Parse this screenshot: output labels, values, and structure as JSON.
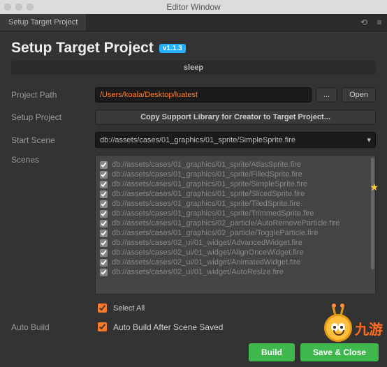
{
  "window": {
    "title": "Editor Window",
    "tab": "Setup Target Project"
  },
  "header": {
    "title": "Setup Target Project",
    "badge": "v1.1.3",
    "subtitle": "sleep"
  },
  "form": {
    "projectPath": {
      "label": "Project Path",
      "value": "/Users/koala/Desktop/luatest",
      "browse": "...",
      "open": "Open"
    },
    "setupProject": {
      "label": "Setup Project",
      "button": "Copy Support Library for Creator to Target Project..."
    },
    "startScene": {
      "label": "Start Scene",
      "value": "db://assets/cases/01_graphics/01_sprite/SimpleSprite.fire"
    },
    "scenesLabel": "Scenes",
    "scenes": [
      "db://assets/cases/01_graphics/01_sprite/AtlasSprite.fire",
      "db://assets/cases/01_graphics/01_sprite/FilledSprite.fire",
      "db://assets/cases/01_graphics/01_sprite/SimpleSprite.fire",
      "db://assets/cases/01_graphics/01_sprite/SlicedSprite.fire",
      "db://assets/cases/01_graphics/01_sprite/TiledSprite.fire",
      "db://assets/cases/01_graphics/01_sprite/TrimmedSprite.fire",
      "db://assets/cases/01_graphics/02_particle/AutoRemoveParticle.fire",
      "db://assets/cases/01_graphics/02_particle/ToggleParticle.fire",
      "db://assets/cases/02_ui/01_widget/AdvancedWidget.fire",
      "db://assets/cases/02_ui/01_widget/AlignOnceWidget.fire",
      "db://assets/cases/02_ui/01_widget/AnimatedWidget.fire",
      "db://assets/cases/02_ui/01_widget/AutoResize.fire"
    ],
    "selectAll": "Select All",
    "autoBuild": {
      "label": "Auto Build",
      "checkbox": "Auto Build After Scene Saved"
    }
  },
  "buttons": {
    "build": "Build",
    "saveClose": "Save & Close"
  },
  "brand": "九游"
}
